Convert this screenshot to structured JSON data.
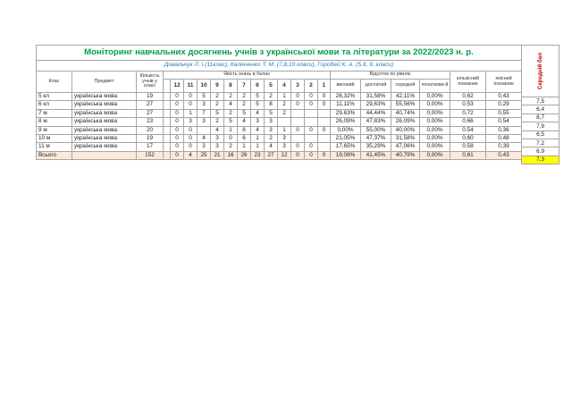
{
  "title": "Моніторинг навчальних досягнень учнів з української мови та літератури за  2022/2023 н. р.",
  "authors": "Довальчук Л. І.(11клас), Калінченко Т. М. (7,8,10 класи), Горобей К. А. (5,6, 9,  класи)",
  "headers": {
    "class": "Клас",
    "subject": "Предмет",
    "count": "Кількість учнів у класі",
    "quality_points": "Якість знань в балах",
    "levels": "Відсоток по рівнях",
    "high": "високий",
    "sufficient": "достатній",
    "middle": "середній",
    "initial": "початкови й",
    "quant_indicator": "кількісний показник",
    "qual_indicator": "якісний показник"
  },
  "grades": [
    "12",
    "11",
    "10",
    "9",
    "8",
    "7",
    "6",
    "5",
    "4",
    "3",
    "2",
    "1"
  ],
  "rows": [
    {
      "class": "5 кл",
      "subject": "українська мова",
      "count": "19",
      "g": [
        "0",
        "0",
        "5",
        "2",
        "2",
        "2",
        "5",
        "2",
        "1",
        "0",
        "0",
        "0"
      ],
      "high": "26,32%",
      "sufficient": "31,58%",
      "middle": "42,11%",
      "initial": "0,00%",
      "quant": "0,62",
      "qual": "0,43",
      "avg": "7,5"
    },
    {
      "class": "6 кл",
      "subject": "українська мова",
      "count": "27",
      "g": [
        "0",
        "0",
        "3",
        "2",
        "4",
        "2",
        "5",
        "8",
        "2",
        "0",
        "0",
        "0"
      ],
      "high": "11,11%",
      "sufficient": "29,63%",
      "middle": "55,56%",
      "initial": "0,00%",
      "quant": "0,53",
      "qual": "0,29",
      "avg": "6,4"
    },
    {
      "class": "7 м",
      "subject": "українська мова",
      "count": "27",
      "g": [
        "0",
        "1",
        "7",
        "5",
        "2",
        "5",
        "4",
        "5",
        "2",
        "",
        "",
        ""
      ],
      "high": "29,63%",
      "sufficient": "44,44%",
      "middle": "40,74%",
      "initial": "0,00%",
      "quant": "0,72",
      "qual": "0,55",
      "avg": "8,7"
    },
    {
      "class": "8 м",
      "subject": "українська мова",
      "count": "23",
      "g": [
        "0",
        "3",
        "3",
        "2",
        "5",
        "4",
        "3",
        "3",
        "",
        "",
        "",
        ""
      ],
      "high": "26,09%",
      "sufficient": "47,83%",
      "middle": "26,09%",
      "initial": "0,00%",
      "quant": "0,66",
      "qual": "0,54",
      "avg": "7,9"
    },
    {
      "class": "9 м",
      "subject": "українська мова",
      "count": "20",
      "g": [
        "0",
        "0",
        "",
        "4",
        "1",
        "6",
        "4",
        "3",
        "1",
        "0",
        "0",
        "0"
      ],
      "high": "0,00%",
      "sufficient": "55,00%",
      "middle": "40,00%",
      "initial": "0,00%",
      "quant": "0,54",
      "qual": "0,36",
      "avg": "6,5"
    },
    {
      "class": "10 м",
      "subject": "українська мова",
      "count": "19",
      "g": [
        "0",
        "0",
        "4",
        "3",
        "0",
        "6",
        "1",
        "2",
        "3",
        "",
        "",
        ""
      ],
      "high": "21,05%",
      "sufficient": "47,37%",
      "middle": "31,58%",
      "initial": "0,00%",
      "quant": "0,60",
      "qual": "0,48",
      "avg": "7,2"
    },
    {
      "class": "11 м",
      "subject": "українська мова",
      "count": "17",
      "g": [
        "0",
        "0",
        "3",
        "3",
        "2",
        "1",
        "1",
        "4",
        "3",
        "0",
        "0",
        ""
      ],
      "high": "17,65%",
      "sufficient": "35,29%",
      "middle": "47,06%",
      "initial": "0,00%",
      "quant": "0,58",
      "qual": "0,39",
      "avg": "6,9"
    }
  ],
  "total": {
    "class": "Всього",
    "count": "152",
    "g": [
      "0",
      "4",
      "25",
      "21",
      "16",
      "26",
      "23",
      "27",
      "12",
      "0",
      "0",
      "0"
    ],
    "high": "19,08%",
    "sufficient": "41,45%",
    "middle": "40,79%",
    "initial": "0,00%",
    "quant": "0,61",
    "qual": "0,43",
    "avg": "7,3"
  },
  "avg_header": "Середній бал",
  "colors": {
    "title": "#00a04a",
    "authors": "#2e75b6",
    "grade_blue": "#1f4e9e",
    "grade_red": "#c00000",
    "total_bg": "#fde9d9",
    "avg_total_bg": "#ffff00"
  }
}
